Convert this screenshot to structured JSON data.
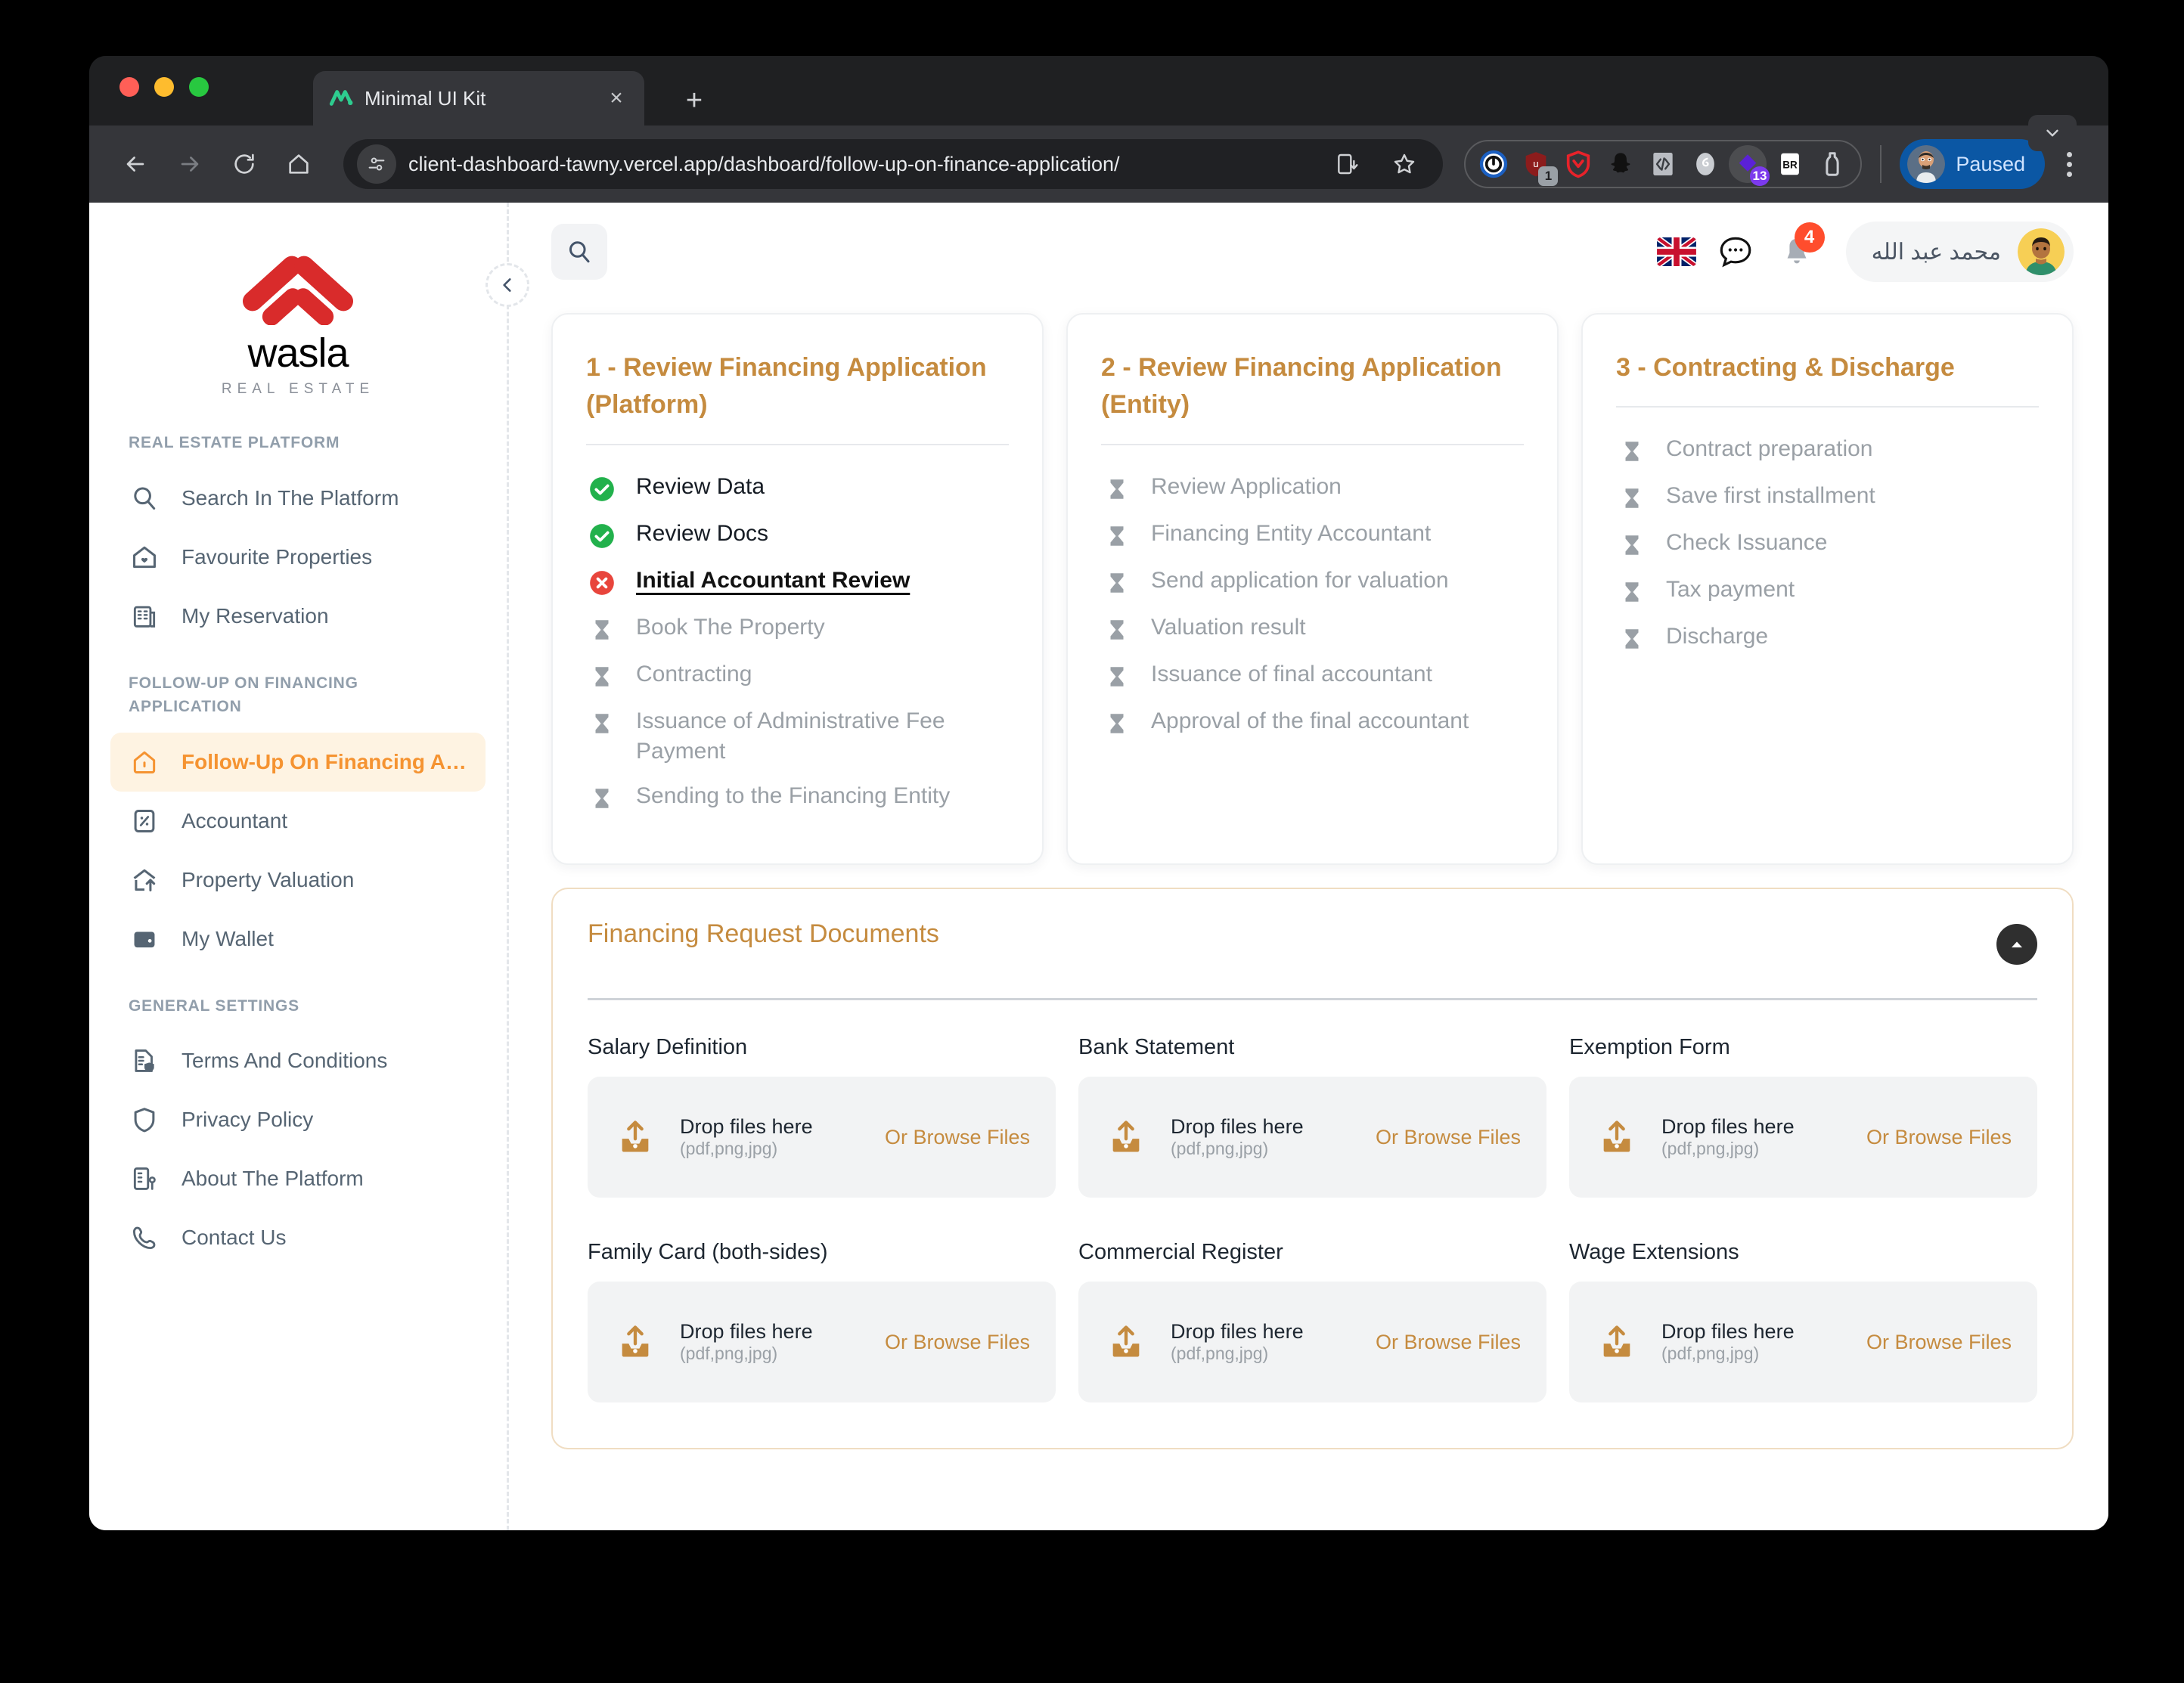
{
  "browser": {
    "tab": {
      "title": "Minimal UI Kit",
      "close_label": "×"
    },
    "new_tab_label": "+",
    "url": "client-dashboard-tawny.vercel.app/dashboard/follow-up-on-finance-application/",
    "extensions": [
      {
        "name": "adblock-icon",
        "badge": ""
      },
      {
        "name": "shield-extension-icon",
        "badge": "1"
      },
      {
        "name": "vshield-extension-icon",
        "badge": ""
      },
      {
        "name": "snapchat-icon",
        "badge": ""
      },
      {
        "name": "code-extension-icon",
        "badge": ""
      },
      {
        "name": "link-extension-icon",
        "badge": ""
      },
      {
        "name": "diamond-extension-icon",
        "badge": "13"
      },
      {
        "name": "br-extension-icon",
        "badge": ""
      },
      {
        "name": "bottle-extension-icon",
        "badge": ""
      }
    ],
    "profile_label": "Paused"
  },
  "sidebar": {
    "logo_word": "wasla",
    "logo_sub": "REAL ESTATE",
    "sections": [
      {
        "title": "REAL ESTATE PLATFORM",
        "items": [
          {
            "label": "Search In The Platform",
            "icon": "search-icon",
            "active": false
          },
          {
            "label": "Favourite Properties",
            "icon": "home-heart-icon",
            "active": false
          },
          {
            "label": "My Reservation",
            "icon": "building-icon",
            "active": false
          }
        ]
      },
      {
        "title": "FOLLOW-UP ON FINANCING APPLICATION",
        "items": [
          {
            "label": "Follow-Up On Financing Ap...",
            "icon": "home-outline-icon",
            "active": true
          },
          {
            "label": "Accountant",
            "icon": "calculator-icon",
            "active": false
          },
          {
            "label": "Property Valuation",
            "icon": "home-up-arrow-icon",
            "active": false
          },
          {
            "label": "My Wallet",
            "icon": "wallet-icon",
            "active": false
          }
        ]
      },
      {
        "title": "GENERAL SETTINGS",
        "items": [
          {
            "label": "Terms And Conditions",
            "icon": "document-shield-icon",
            "active": false
          },
          {
            "label": "Privacy Policy",
            "icon": "shield-icon",
            "active": false
          },
          {
            "label": "About The Platform",
            "icon": "building-info-icon",
            "active": false
          },
          {
            "label": "Contact Us",
            "icon": "phone-icon",
            "active": false
          }
        ]
      }
    ]
  },
  "topbar": {
    "language_flag": "uk-flag-icon",
    "chat_icon": "chat-bubble-icon",
    "notifications_badge": "4",
    "user_name": "محمد عبد الله"
  },
  "steps": [
    {
      "title": "1 - Review Financing Application (Platform)",
      "items": [
        {
          "label": "Review Data",
          "status": "done"
        },
        {
          "label": "Review Docs",
          "status": "done"
        },
        {
          "label": "Initial Accountant Review",
          "status": "rejected"
        },
        {
          "label": "Book The Property",
          "status": "pending"
        },
        {
          "label": "Contracting",
          "status": "pending"
        },
        {
          "label": "Issuance of Administrative Fee Payment",
          "status": "pending"
        },
        {
          "label": "Sending to the Financing Entity",
          "status": "pending"
        }
      ]
    },
    {
      "title": "2 - Review Financing Application (Entity)",
      "items": [
        {
          "label": "Review Application",
          "status": "pending"
        },
        {
          "label": "Financing Entity Accountant",
          "status": "pending"
        },
        {
          "label": "Send application for valuation",
          "status": "pending"
        },
        {
          "label": "Valuation result",
          "status": "pending"
        },
        {
          "label": "Issuance of final accountant",
          "status": "pending"
        },
        {
          "label": "Approval of the final accountant",
          "status": "pending"
        }
      ]
    },
    {
      "title": "3 - Contracting & Discharge",
      "items": [
        {
          "label": "Contract preparation",
          "status": "pending"
        },
        {
          "label": "Save first installment",
          "status": "pending"
        },
        {
          "label": "Check Issuance",
          "status": "pending"
        },
        {
          "label": "Tax payment",
          "status": "pending"
        },
        {
          "label": "Discharge",
          "status": "pending"
        }
      ]
    }
  ],
  "documents": {
    "title": "Financing Request Documents",
    "drop_text": "Drop files here",
    "formats": "(pdf,png,jpg)",
    "browse_label": "Or Browse Files",
    "items": [
      {
        "label": "Salary Definition"
      },
      {
        "label": "Bank Statement"
      },
      {
        "label": "Exemption Form"
      },
      {
        "label": "Family Card (both-sides)"
      },
      {
        "label": "Commercial Register"
      },
      {
        "label": "Wage Extensions"
      }
    ]
  },
  "colors": {
    "accent_orange": "#f59331",
    "gold": "#c58b3f",
    "brand_red": "#d92b2b",
    "success_green": "#22b14c",
    "error_red": "#e8453c"
  }
}
